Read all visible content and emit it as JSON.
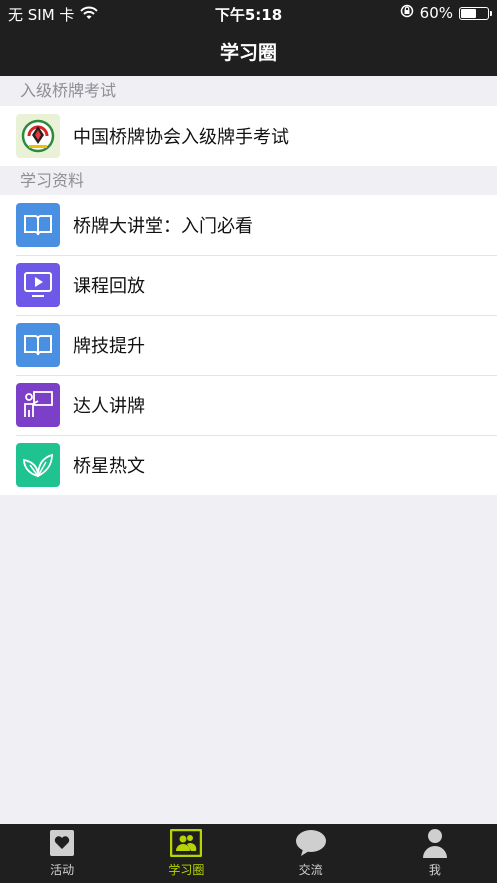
{
  "status_bar": {
    "carrier": "无 SIM 卡",
    "time": "下午5:18",
    "battery_text": "60%",
    "battery_level": 0.6
  },
  "nav": {
    "title": "学习圈"
  },
  "sections": [
    {
      "header": "入级桥牌考试",
      "items": [
        {
          "label": "中国桥牌协会入级牌手考试",
          "icon": "bridge-association-logo-icon"
        }
      ]
    },
    {
      "header": "学习资料",
      "items": [
        {
          "label": "桥牌大讲堂：入门必看",
          "icon": "book-icon",
          "color": "#4a90e2"
        },
        {
          "label": "课程回放",
          "icon": "play-screen-icon",
          "color": "#6d58e8"
        },
        {
          "label": "牌技提升",
          "icon": "book-icon",
          "color": "#4a90e2"
        },
        {
          "label": "达人讲牌",
          "icon": "lecturer-icon",
          "color": "#7b3fc8"
        },
        {
          "label": "桥星热文",
          "icon": "leaf-icon",
          "color": "#1fc38f"
        }
      ]
    }
  ],
  "tabs": [
    {
      "label": "活动",
      "icon": "heart-card-icon",
      "active": false
    },
    {
      "label": "学习圈",
      "icon": "group-board-icon",
      "active": true
    },
    {
      "label": "交流",
      "icon": "chat-bubble-icon",
      "active": false
    },
    {
      "label": "我",
      "icon": "person-icon",
      "active": false
    }
  ],
  "colors": {
    "bar_background": "#1f1f1f",
    "active_tab": "#b8d400",
    "page_background": "#efeff4"
  }
}
